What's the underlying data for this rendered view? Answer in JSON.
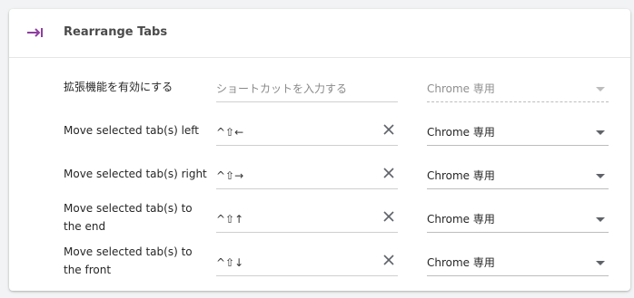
{
  "extension": {
    "name": "Rearrange Tabs",
    "icon": "tab-to-end-icon",
    "accent_color": "#8e3fa0"
  },
  "commands": [
    {
      "label": "拡張機能を有効にする",
      "shortcut": "",
      "placeholder": "ショートカットを入力する",
      "scope": "Chrome 専用",
      "has_clear": false,
      "scope_disabled": true
    },
    {
      "label": "Move selected tab(s) left",
      "shortcut": "^⇧←",
      "placeholder": "",
      "scope": "Chrome 専用",
      "has_clear": true,
      "scope_disabled": false
    },
    {
      "label": "Move selected tab(s) right",
      "shortcut": "^⇧→",
      "placeholder": "",
      "scope": "Chrome 専用",
      "has_clear": true,
      "scope_disabled": false
    },
    {
      "label": "Move selected tab(s) to the end",
      "shortcut": "^⇧↑",
      "placeholder": "",
      "scope": "Chrome 専用",
      "has_clear": true,
      "scope_disabled": false
    },
    {
      "label": "Move selected tab(s) to the front",
      "shortcut": "^⇧↓",
      "placeholder": "",
      "scope": "Chrome 専用",
      "has_clear": true,
      "scope_disabled": false
    }
  ]
}
